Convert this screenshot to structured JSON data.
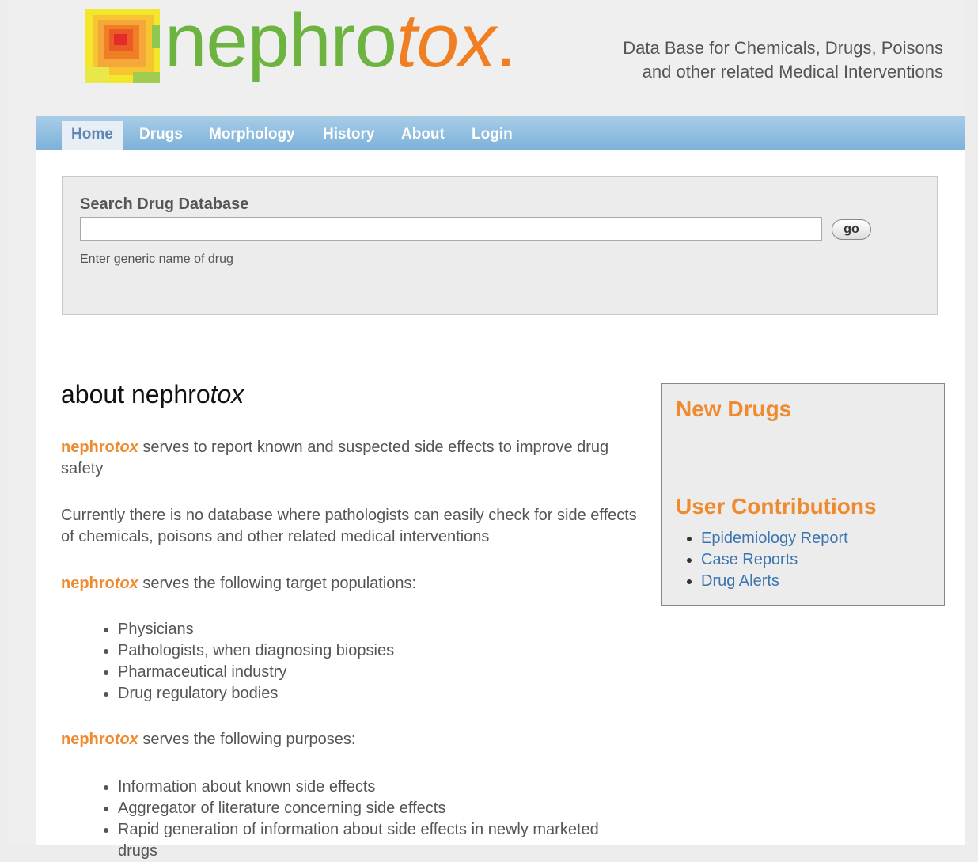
{
  "header": {
    "logo_prefix": "nephro",
    "logo_suffix": "tox",
    "logo_dot": ".",
    "tagline_line1": "Data Base for Chemicals, Drugs, Poisons",
    "tagline_line2": "and other related Medical Interventions"
  },
  "nav": {
    "items": [
      {
        "label": "Home",
        "active": true
      },
      {
        "label": "Drugs"
      },
      {
        "label": "Morphology"
      },
      {
        "label": "History"
      },
      {
        "label": "About"
      },
      {
        "label": "Login"
      }
    ]
  },
  "search": {
    "title": "Search Drug Database",
    "value": "",
    "go_label": "go",
    "hint": "Enter generic name of drug"
  },
  "about": {
    "heading_prefix": "about nephro",
    "heading_suffix": "tox",
    "brand_prefix": "nephro",
    "brand_suffix": "tox",
    "p1": " serves to report known and suspected side effects to improve drug safety",
    "p2": "Currently there is no database where pathologists can easily check for side effects of chemicals, poisons and other related medical interventions",
    "p3": " serves the following target populations:",
    "populations": [
      "Physicians",
      "Pathologists, when diagnosing biopsies",
      "Pharmaceutical industry",
      "Drug regulatory bodies"
    ],
    "p4": " serves the following purposes:",
    "purposes": [
      "Information about known side effects",
      "Aggregator of literature concerning side effects",
      "Rapid generation of information about side effects in newly marketed drugs"
    ]
  },
  "sidebar": {
    "new_drugs_title": "New Drugs",
    "contrib_title": "User Contributions",
    "links": [
      "Epidemiology Report",
      "Case Reports",
      "Drug Alerts"
    ]
  },
  "colors": {
    "brand_green": "#6cb33f",
    "brand_orange": "#ef7f22",
    "nav_blue": "#7eb2d9",
    "link_blue": "#3d74b0"
  }
}
